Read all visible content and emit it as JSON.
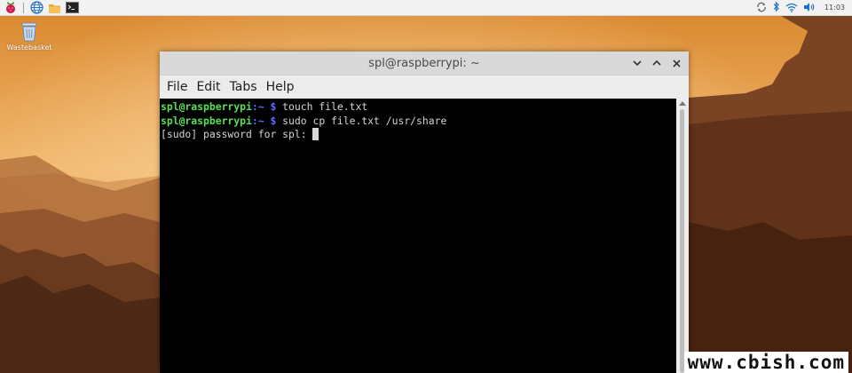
{
  "panel": {
    "clock": "11:03",
    "launchers": [
      "raspberry-menu",
      "web-browser",
      "file-manager",
      "terminal"
    ],
    "tray_icons": [
      "update-icon",
      "bluetooth-icon",
      "wifi-icon",
      "volume-icon"
    ]
  },
  "desktop": {
    "trash_label": "Wastebasket"
  },
  "window": {
    "title": "spl@raspberrypi: ~",
    "menu": [
      "File",
      "Edit",
      "Tabs",
      "Help"
    ]
  },
  "terminal": {
    "lines": [
      {
        "user": "spl@raspberrypi",
        "path": ":~ $",
        "cmd": " touch file.txt"
      },
      {
        "user": "spl@raspberrypi",
        "path": ":~ $",
        "cmd": " sudo cp file.txt /usr/share"
      }
    ],
    "prompt_line": "[sudo] password for spl: "
  },
  "watermark": "www.cbish.com",
  "colors": {
    "user": "#58e05a",
    "path": "#5d6dff",
    "sky_top": "#e2a14f",
    "sky_glow": "#f6c98b"
  }
}
